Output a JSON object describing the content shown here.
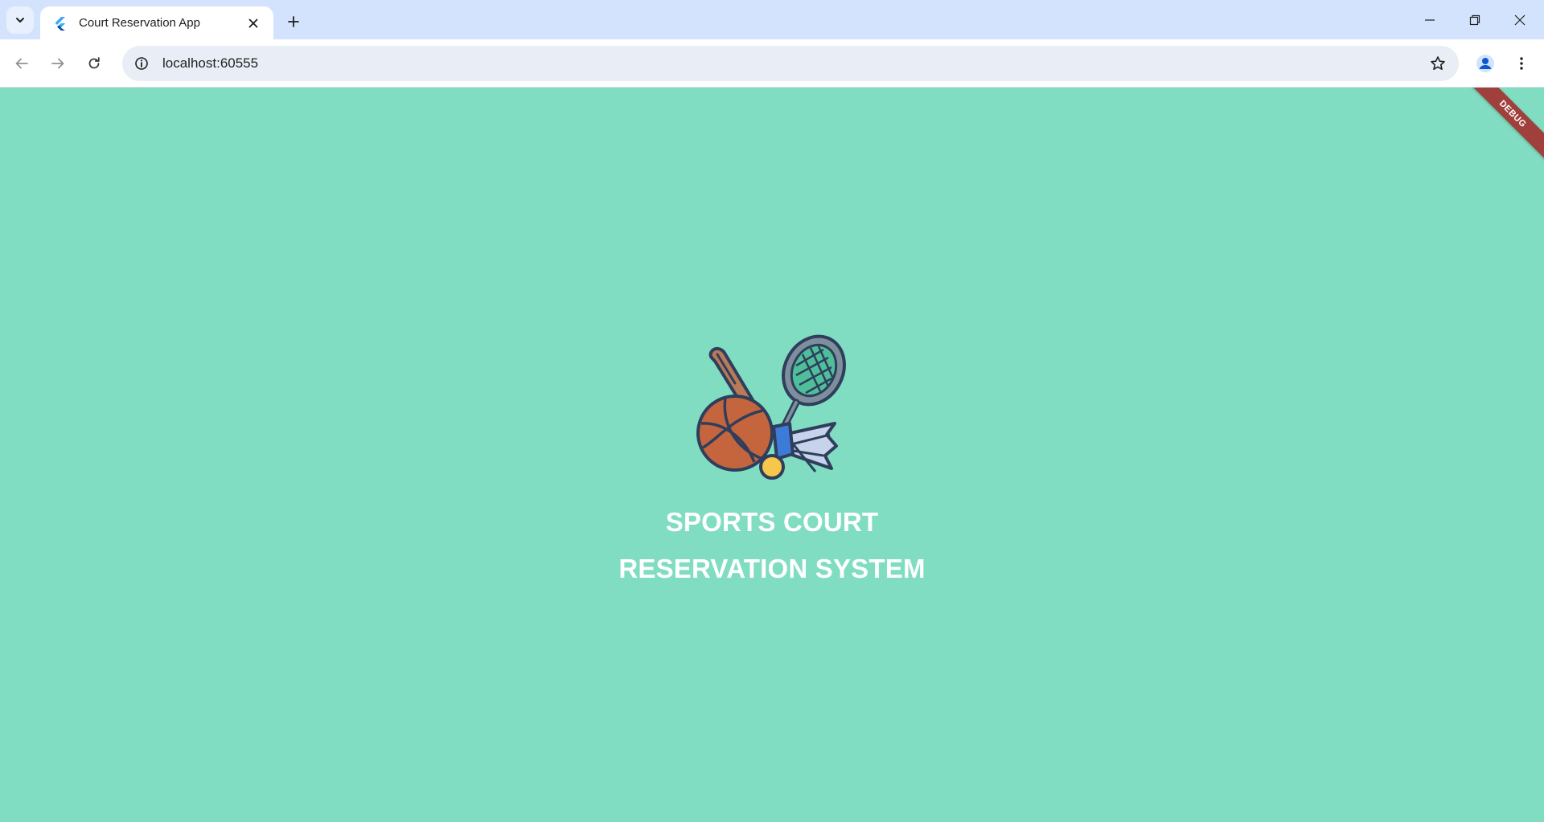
{
  "browser": {
    "tab_title": "Court Reservation App",
    "url": "localhost:60555"
  },
  "app": {
    "debug_banner": "DEBUG",
    "title_line1": "SPORTS COURT",
    "title_line2": "RESERVATION SYSTEM",
    "background_color": "#80ddc2"
  },
  "icons": [
    "tab-search-icon",
    "flutter-favicon-icon",
    "close-icon",
    "plus-icon",
    "minimize-icon",
    "restore-icon",
    "window-close-icon",
    "back-arrow-icon",
    "forward-arrow-icon",
    "reload-icon",
    "site-info-icon",
    "star-icon",
    "profile-icon",
    "more-menu-icon",
    "sports-logo-icon"
  ]
}
